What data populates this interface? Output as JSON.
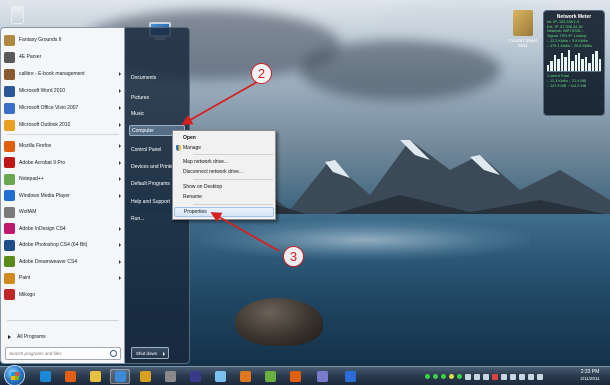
{
  "start_menu": {
    "pinned": [
      {
        "label": "Fantasy Grounds II",
        "icon": "fantasy-grounds-icon",
        "color": "#b08840",
        "has_arrow": false
      },
      {
        "label": "4E Parser",
        "icon": "parser-icon",
        "color": "#5a5a5a",
        "has_arrow": false
      },
      {
        "label": "calibre - E-book management",
        "icon": "calibre-icon",
        "color": "#8a5a30",
        "has_arrow": true
      },
      {
        "label": "Microsoft Word 2010",
        "icon": "word-icon",
        "color": "#2b5797",
        "has_arrow": true
      },
      {
        "label": "Microsoft Office Visio 2007",
        "icon": "visio-icon",
        "color": "#3a6ec8",
        "has_arrow": true
      },
      {
        "label": "Microsoft Outlook 2010",
        "icon": "outlook-icon",
        "color": "#e8a020",
        "has_arrow": true
      },
      {
        "label": "Mozilla Firefox",
        "icon": "firefox-icon",
        "color": "#e06010",
        "has_arrow": true
      },
      {
        "label": "Adobe Acrobat 9 Pro",
        "icon": "acrobat-icon",
        "color": "#c01818",
        "has_arrow": true
      },
      {
        "label": "Notepad++",
        "icon": "notepad-plus-icon",
        "color": "#6aa84f",
        "has_arrow": true
      },
      {
        "label": "Windows Media Player",
        "icon": "media-player-icon",
        "color": "#1e6fd0",
        "has_arrow": true
      },
      {
        "label": "WolfAM",
        "icon": "wolfam-icon",
        "color": "#7a7a7a",
        "has_arrow": false
      },
      {
        "label": "Adobe InDesign CS4",
        "icon": "indesign-icon",
        "color": "#c0186c",
        "has_arrow": true
      },
      {
        "label": "Adobe Photoshop CS4 (64 Bit)",
        "icon": "photoshop-icon",
        "color": "#1d4e8a",
        "has_arrow": true
      },
      {
        "label": "Adobe Dreamweaver CS4",
        "icon": "dreamweaver-icon",
        "color": "#5a8a1a",
        "has_arrow": true
      },
      {
        "label": "Paint",
        "icon": "paint-icon",
        "color": "#d08a20",
        "has_arrow": true
      },
      {
        "label": "Mikogo",
        "icon": "mikogo-icon",
        "color": "#c02828",
        "has_arrow": false
      }
    ],
    "all_programs_label": "All Programs",
    "search_placeholder": "Search programs and files",
    "places": [
      {
        "label": "Documents",
        "highlighted": false
      },
      {
        "label": "Pictures",
        "highlighted": false
      },
      {
        "label": "Music",
        "highlighted": false
      },
      {
        "label": "Computer",
        "highlighted": true
      },
      {
        "label": "Control Panel",
        "highlighted": false
      },
      {
        "label": "Devices and Printers",
        "highlighted": false
      },
      {
        "label": "Default Programs",
        "highlighted": false
      },
      {
        "label": "Help and Support",
        "highlighted": false
      },
      {
        "label": "Run...",
        "highlighted": false
      }
    ],
    "shutdown_label": "Shut down"
  },
  "context_menu": {
    "items": [
      {
        "label": "Open",
        "bold": true,
        "highlighted": false,
        "shield": false
      },
      {
        "label": "Manage",
        "bold": false,
        "highlighted": false,
        "shield": true
      },
      {
        "label": "Map network drive...",
        "bold": false,
        "highlighted": false,
        "shield": false
      },
      {
        "label": "Disconnect network drive...",
        "bold": false,
        "highlighted": false,
        "shield": false
      },
      {
        "label": "Show on Desktop",
        "bold": false,
        "highlighted": false,
        "shield": false
      },
      {
        "label": "Rename",
        "bold": false,
        "highlighted": false,
        "shield": false
      },
      {
        "label": "Properties",
        "bold": false,
        "highlighted": true,
        "shield": false
      }
    ]
  },
  "annotations": {
    "callout_2": "2",
    "callout_3": "3",
    "color": "#d62020"
  },
  "desktop": {
    "contact_label": "Contact Sheet 2011",
    "network_meter": {
      "title": "Network Meter",
      "lines": [
        "Int. IP: 192.168.1.5",
        "Ext. IP: 67.208.34.18",
        "Network: WiFi  SSID: -",
        "Signal: 79%  IP: Lookup",
        "↓ 12.3 Kbit/s  ↑ 3.9 Kbit/s",
        "↓ 479.1 Kbit/s  ↑ 20.8 Kbit/s"
      ],
      "graph": [
        0.3,
        0.5,
        0.8,
        0.6,
        0.9,
        0.7,
        1.0,
        0.5,
        0.8,
        0.9,
        0.6,
        0.7,
        0.4,
        0.85,
        0.95,
        0.6
      ],
      "footer_lines": [
        "Current      Total",
        "↓ 12.3 Kbit/s  ↓ 21.4 MB",
        "↑ 147.9 MB   ↑ 114.2 MB"
      ]
    }
  },
  "taskbar": {
    "clock_time": "2:33 PM",
    "clock_date": "2/11/2011",
    "pinned_colors": [
      "#1e88d8",
      "#e06010",
      "#e8c040",
      "#3a8ad8",
      "#d8a020",
      "#8a8a8a",
      "#3a3a8a",
      "#7ac0f0",
      "#e07820",
      "#6ab040",
      "#e06010",
      "#7a7acc",
      "#2a6cd8"
    ]
  }
}
